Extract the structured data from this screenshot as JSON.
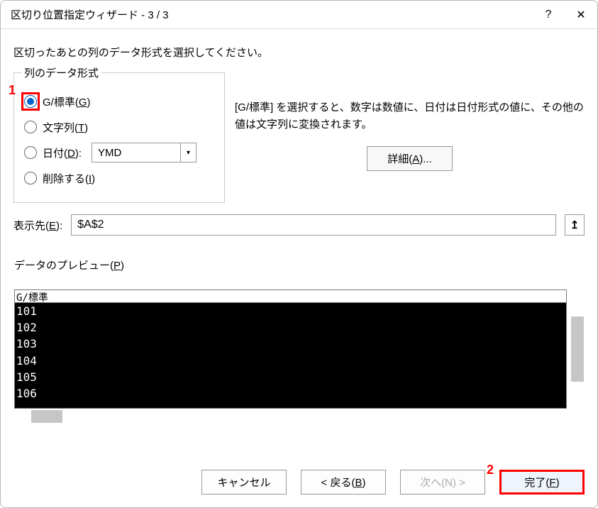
{
  "titlebar": {
    "title": "区切り位置指定ウィザード - 3 / 3",
    "help": "?",
    "close": "✕"
  },
  "instruction": "区切ったあとの列のデータ形式を選択してください。",
  "column_format": {
    "legend": "列のデータ形式",
    "general_pre": "G/標準(",
    "general_u": "G",
    "general_post": ")",
    "text_pre": "文字列(",
    "text_u": "T",
    "text_post": ")",
    "date_pre": "日付(",
    "date_u": "D",
    "date_post": "):",
    "date_value": "YMD",
    "skip_pre": "削除する(",
    "skip_u": "I",
    "skip_post": ")"
  },
  "description": {
    "text": "[G/標準] を選択すると、数字は数値に、日付は日付形式の値に、その他の値は文字列に変換されます。",
    "detail_pre": "詳細(",
    "detail_u": "A",
    "detail_post": ")..."
  },
  "destination": {
    "label_pre": "表示先(",
    "label_u": "E",
    "label_post": "):",
    "value": "$A$2",
    "picker": "↥"
  },
  "preview": {
    "label_pre": "データのプレビュー(",
    "label_u": "P",
    "label_post": ")",
    "header": "G/標準",
    "chart_data": {
      "type": "table",
      "columns": [
        "G/標準"
      ],
      "rows": [
        "101",
        "102",
        "103",
        "104",
        "105",
        "106"
      ]
    }
  },
  "buttons": {
    "cancel": "キャンセル",
    "back_pre": "< 戻る(",
    "back_u": "B",
    "back_post": ")",
    "next": "次へ(N) >",
    "finish_pre": "完了(",
    "finish_u": "F",
    "finish_post": ")"
  },
  "markers": {
    "m1": "1",
    "m2": "2"
  }
}
